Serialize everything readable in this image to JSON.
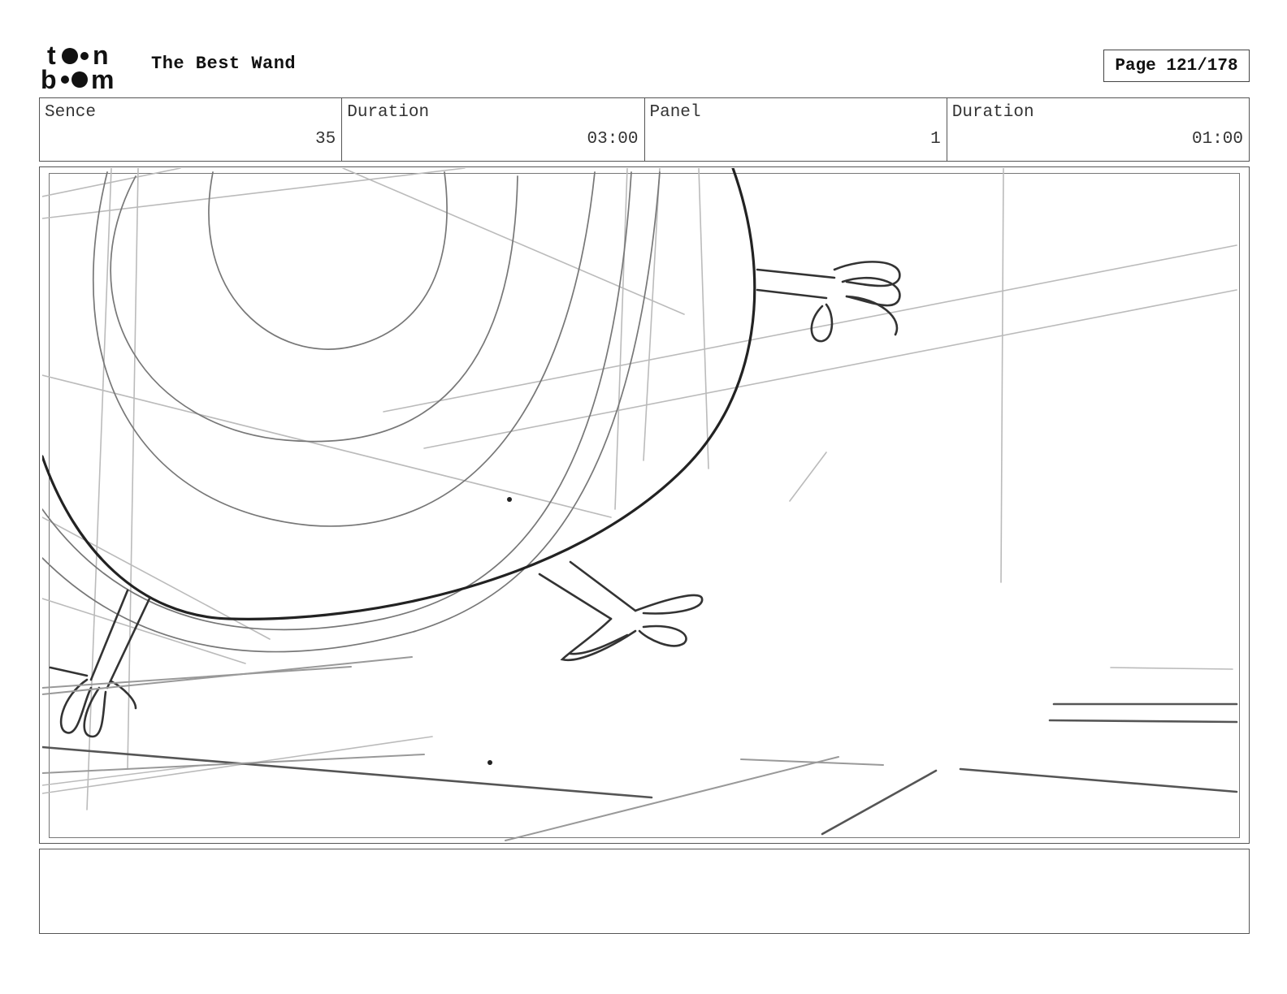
{
  "header": {
    "logo_text": "toon boom",
    "title": "The Best Wand",
    "page_label": "Page 121/178"
  },
  "info": {
    "scene_label": "Sence",
    "scene_value": "35",
    "scene_duration_label": "Duration",
    "scene_duration_value": "03:00",
    "panel_label": "Panel",
    "panel_value": "1",
    "panel_duration_label": "Duration",
    "panel_duration_value": "01:00"
  },
  "notes": {
    "text": ""
  }
}
